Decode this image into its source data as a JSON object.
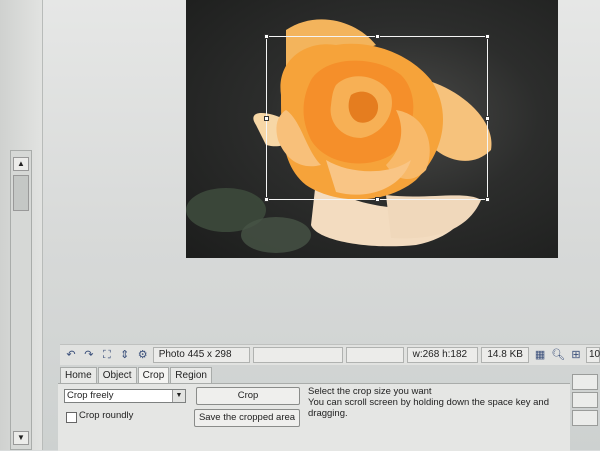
{
  "photo_info": "Photo 445 x 298",
  "selection_size": "w:268 h:182",
  "file_size": "14.8 KB",
  "zoom_partial": "10",
  "scroll": {
    "up": "▲",
    "down": "▼"
  },
  "tabs": [
    "Home",
    "Object",
    "Crop",
    "Region"
  ],
  "active_tab": "Crop",
  "crop_mode": "Crop freely",
  "crop_roundly_label": "Crop roundly",
  "crop_button": "Crop",
  "save_button": "Save the cropped area",
  "help_text": "Select the crop size you want\nYou can scroll screen by holding down the space key and dragging.",
  "colors": {
    "rose": "#f6a33a",
    "background_dark": "#2c2d2c"
  }
}
